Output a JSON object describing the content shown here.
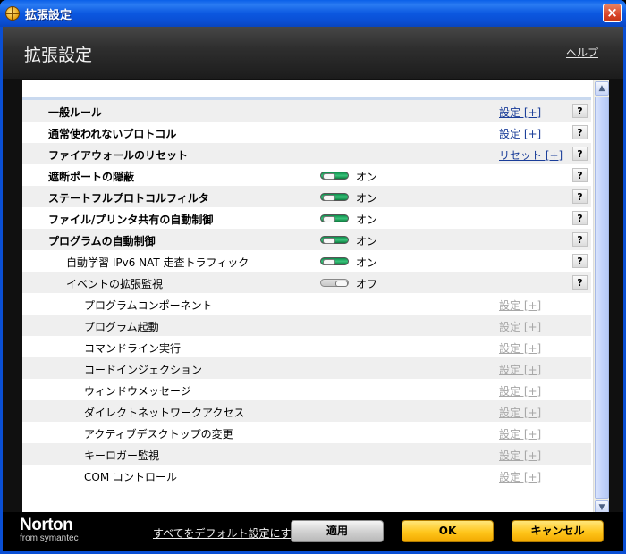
{
  "window": {
    "title": "拡張設定"
  },
  "header": {
    "title": "拡張設定",
    "help": "ヘルプ"
  },
  "rows": [
    {
      "label": "一般ルール",
      "level": 0,
      "action": "設定 [+]",
      "help": "?"
    },
    {
      "label": "通常使われないプロトコル",
      "level": 0,
      "action": "設定 [+]",
      "help": "?"
    },
    {
      "label": "ファイアウォールのリセット",
      "level": 0,
      "action": "リセット [+]",
      "help": "?"
    },
    {
      "label": "遮断ポートの隠蔽",
      "level": 0,
      "toggle": "オン",
      "help": "?"
    },
    {
      "label": "ステートフルプロトコルフィルタ",
      "level": 0,
      "toggle": "オン",
      "help": "?"
    },
    {
      "label": "ファイル/プリンタ共有の自動制御",
      "level": 0,
      "toggle": "オン",
      "help": "?"
    },
    {
      "label": "プログラムの自動制御",
      "level": 0,
      "toggle": "オン",
      "help": "?"
    },
    {
      "label": "自動学習 IPv6 NAT 走査トラフィック",
      "level": 1,
      "toggle": "オン",
      "help": "?"
    },
    {
      "label": "イベントの拡張監視",
      "level": 1,
      "toggle": "オフ",
      "help": "?"
    },
    {
      "label": "プログラムコンポーネント",
      "level": 2,
      "action": "設定 [+]",
      "disabled": true
    },
    {
      "label": "プログラム起動",
      "level": 2,
      "action": "設定 [+]",
      "disabled": true
    },
    {
      "label": "コマンドライン実行",
      "level": 2,
      "action": "設定 [+]",
      "disabled": true
    },
    {
      "label": "コードインジェクション",
      "level": 2,
      "action": "設定 [+]",
      "disabled": true
    },
    {
      "label": "ウィンドウメッセージ",
      "level": 2,
      "action": "設定 [+]",
      "disabled": true
    },
    {
      "label": "ダイレクトネットワークアクセス",
      "level": 2,
      "action": "設定 [+]",
      "disabled": true
    },
    {
      "label": "アクティブデスクトップの変更",
      "level": 2,
      "action": "設定 [+]",
      "disabled": true
    },
    {
      "label": "キーロガー監視",
      "level": 2,
      "action": "設定 [+]",
      "disabled": true
    },
    {
      "label": "COM コントロール",
      "level": 2,
      "action": "設定 [+]",
      "disabled": true
    }
  ],
  "footer": {
    "brand": "Norton",
    "brand_sub": "from symantec",
    "default_link": "すべてをデフォルト設定にする",
    "apply": "適用",
    "ok": "OK",
    "cancel": "キャンセル"
  },
  "colors": {
    "header_bg": "#2f2f2f",
    "ok_yellow": "#ffc51a",
    "toggle_on": "#2bb86a",
    "link": "#1a3d99"
  }
}
